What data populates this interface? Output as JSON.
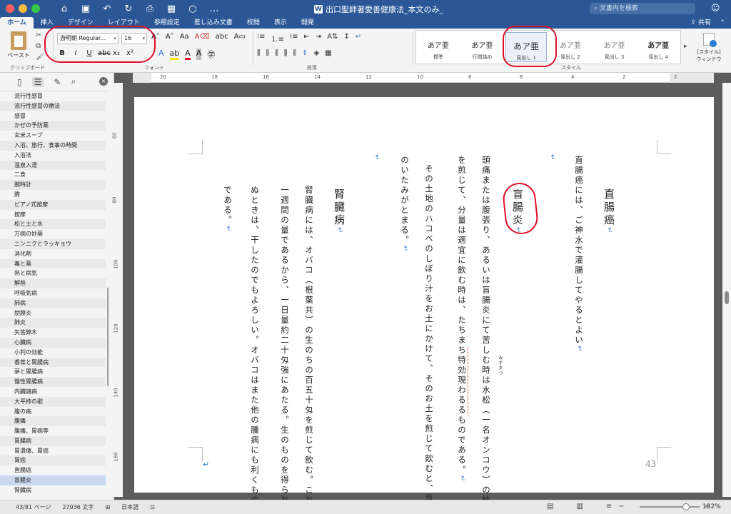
{
  "titlebar": {
    "title": "出口聖師著愛善健康法_本文のみ_",
    "search_placeholder": "文書内を検索"
  },
  "ribbon_tabs": [
    "ホーム",
    "挿入",
    "デザイン",
    "レイアウト",
    "参照設定",
    "差し込み文書",
    "校閲",
    "表示",
    "開発"
  ],
  "share_label": "共有",
  "clipboard": {
    "paste_label": "ペースト",
    "group_label": "クリップボード"
  },
  "font": {
    "name": "游明朝 Regular...",
    "size": "16",
    "group_label": "フォント"
  },
  "paragraph": {
    "group_label": "段落"
  },
  "styles": {
    "group_label": "スタイル",
    "items": [
      {
        "preview": "あア亜",
        "name": "標準"
      },
      {
        "preview": "あア亜",
        "name": "行間詰め"
      },
      {
        "preview": "あア亜",
        "name": "見出し 1"
      },
      {
        "preview": "あア亜",
        "name": "見出し 2"
      },
      {
        "preview": "あア亜",
        "name": "見出し 3"
      },
      {
        "preview": "あア亜",
        "name": "見出し 4"
      }
    ],
    "window_label_1": "[スタイル]",
    "window_label_2": "ウィンドウ"
  },
  "sidebar": {
    "items": [
      "流行性感冒",
      "流行性感冒の療法",
      "感冒",
      "かぜの予防薬",
      "玄米スープ",
      "入浴、旅行、食事の時間",
      "入浴法",
      "温泉入湯",
      "二食",
      "腕時計",
      "膵",
      "ピアノ式按摩",
      "按摩",
      "松と土と水",
      "万病の妙薬",
      "ニンニクとラッキョウ",
      "消化剤",
      "毒と薬",
      "熱と病気",
      "解熱",
      "呼吸気病",
      "肺病",
      "肋膜炎",
      "肺炎",
      "矢筈錦木",
      "心臓病",
      "小判の効能",
      "香茸と胃腸病",
      "夢と胃腸病",
      "慢性胃腸病",
      "内臓諸病",
      "大平柿の歌",
      "腹の病",
      "腹痛",
      "腹痛、胃病等",
      "胃腸病",
      "胃潰瘍、胃癌",
      "胃癌",
      "直腸癌",
      "盲腸炎",
      "腎臓病"
    ],
    "selected_index": 39
  },
  "hruler_ticks": [
    "20",
    "18",
    "16",
    "14",
    "12",
    "10",
    "8",
    "6",
    "4",
    "2",
    "2"
  ],
  "vruler_ticks": [
    "60",
    "80",
    "100",
    "120",
    "140",
    "160"
  ],
  "page": {
    "heading_1": "直腸癌",
    "line_1": "直腸癌には、ご神水で灌腸してやるとよい",
    "heading_2": "盲腸炎",
    "line_2": "頭痛または腹張り、あるいは盲腸炎にて苦しむ時は水松（一名オンコウ）の枝",
    "line_3": "を煎じて、分量は適宜に飲む時は、たちまち特効現わるるものである。",
    "line_4": "その土地のハコベのしぼり汁をお土にかけて、そのお土を煎じて飲むと、盲腸",
    "line_5": "のいたみがとまる。",
    "heading_3": "腎臓病",
    "line_6": "腎臓病には、オバコ（根葉共）の生のちの百五十匁を煎じて飲む。これは",
    "line_7": "一週間の量であるから、一日量約二十匁強にあたる。生のものを得られ",
    "line_8": "ぬときは、干したのでもよろしい。オバコはまた他の腫病にも利くもの",
    "line_9": "である。",
    "furigana": "みずまつ",
    "page_number": "43"
  },
  "status": {
    "page": "43/81 ページ",
    "words": "27936 文字",
    "language": "日本語",
    "zoom": "132%"
  }
}
